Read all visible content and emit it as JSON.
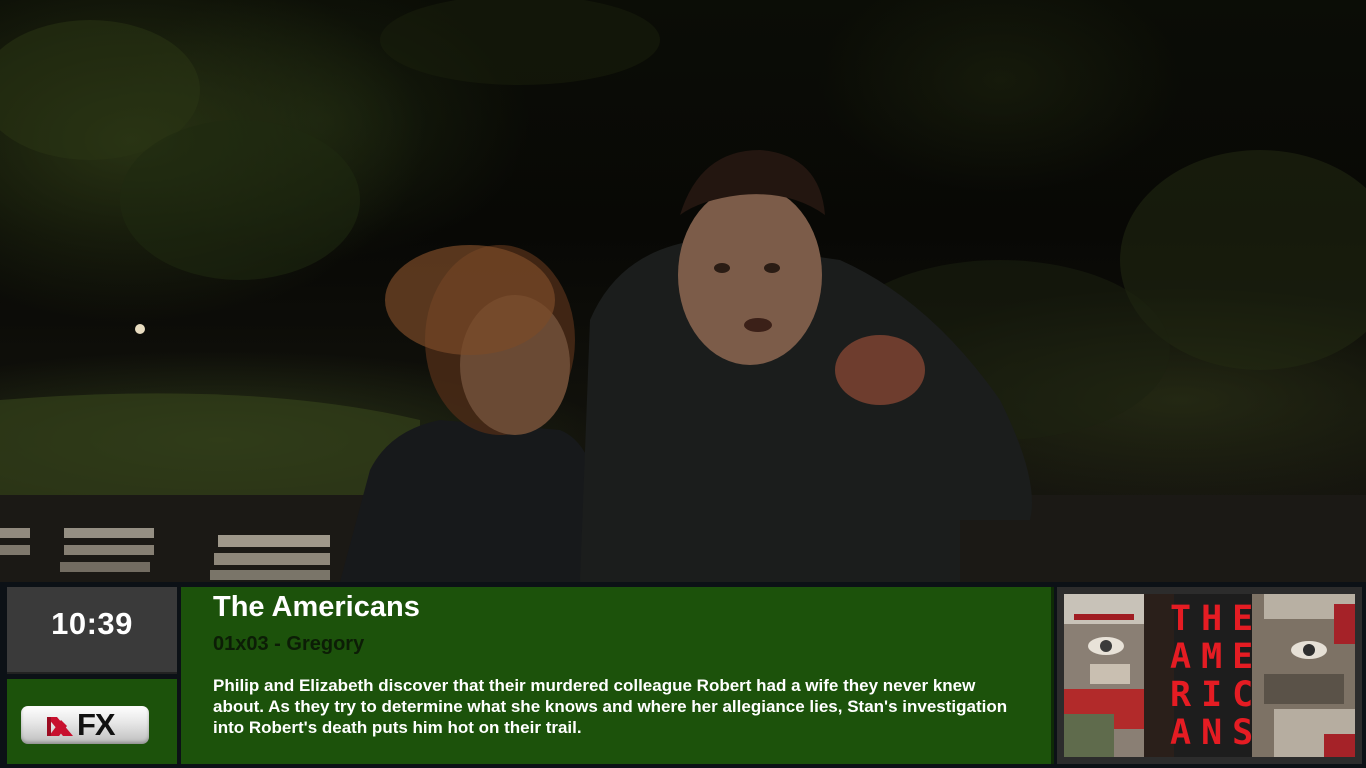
{
  "clock": {
    "time": "10:39"
  },
  "channel": {
    "logo_text": "FX"
  },
  "show": {
    "title": "The Americans",
    "episode": "01x03 - Gregory",
    "plot": "Philip and Elizabeth discover that their murdered colleague Robert had a wife they never knew about. As they try to determine what she knows and where her allegiance lies, Stan's investigation into Robert's death puts him hot on their trail."
  },
  "poster": {
    "title_text": "THE\nAME\nRIC\nANS"
  },
  "colors": {
    "panel_green": "#1c520b",
    "clock_gray": "#3a3a3a",
    "poster_red": "#e51c23"
  },
  "icons": {
    "channel_logo": "fx-logo",
    "poster_art": "show-poster"
  }
}
